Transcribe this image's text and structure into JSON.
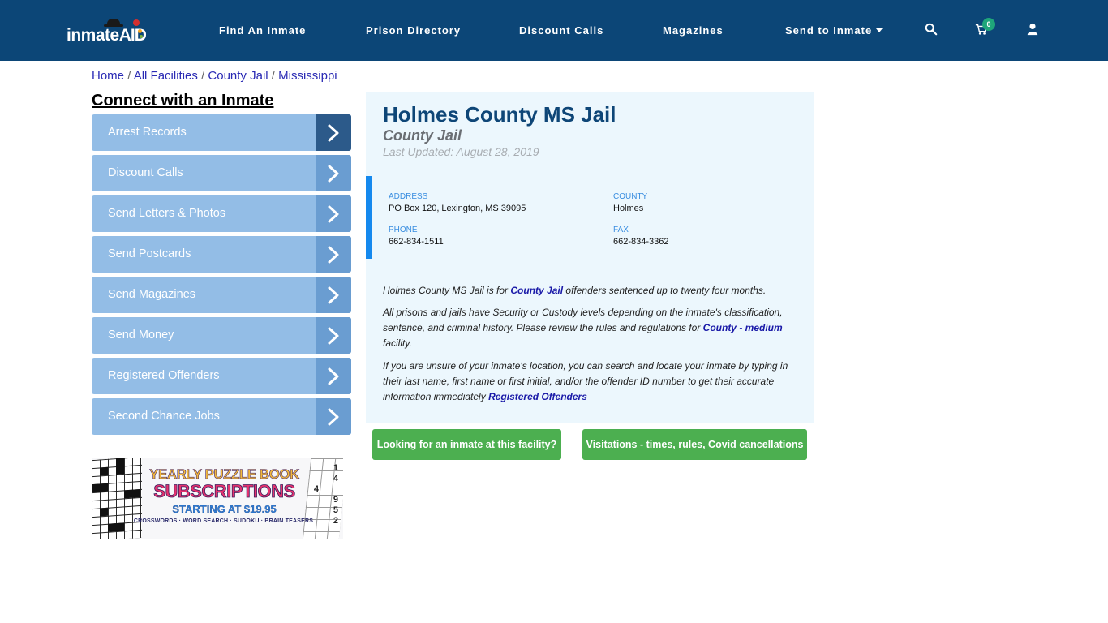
{
  "header": {
    "logo": {
      "text_main": "inmate",
      "text_accent": "AID"
    },
    "nav": [
      {
        "label": "Find An Inmate"
      },
      {
        "label": "Prison Directory"
      },
      {
        "label": "Discount Calls"
      },
      {
        "label": "Magazines"
      },
      {
        "label": "Send to Inmate",
        "has_dropdown": true
      }
    ],
    "icons": {
      "search": "search-icon",
      "cart": "cart-icon",
      "user": "user-icon"
    },
    "cart_count": "0",
    "colors": {
      "background": "#0c4677",
      "badge": "#1fa67a"
    }
  },
  "breadcrumb": [
    {
      "label": "Home"
    },
    {
      "label": "All Facilities"
    },
    {
      "label": "County Jail"
    },
    {
      "label": "Mississippi"
    }
  ],
  "breadcrumb_separator": "/",
  "sidebar": {
    "title": "Connect with an Inmate",
    "items": [
      {
        "label": "Arrest Records",
        "active": true
      },
      {
        "label": "Discount Calls"
      },
      {
        "label": "Send Letters & Photos"
      },
      {
        "label": "Send Postcards"
      },
      {
        "label": "Send Magazines"
      },
      {
        "label": "Send Money"
      },
      {
        "label": "Registered Offenders"
      },
      {
        "label": "Second Chance Jobs"
      }
    ],
    "ad": {
      "line1": "YEARLY PUZZLE BOOK",
      "line2": "SUBSCRIPTIONS",
      "line3": "STARTING AT $19.95",
      "line4": "CROSSWORDS · WORD SEARCH · SUDOKU · BRAIN TEASERS",
      "sudoku_digits": [
        "1",
        "4",
        "4",
        "9",
        "5",
        "2"
      ]
    }
  },
  "facility": {
    "name": "Holmes County MS Jail",
    "type": "County Jail",
    "last_updated": "Last Updated: August 28, 2019",
    "address_label": "ADDRESS",
    "address": "PO Box 120, Lexington, MS 39095",
    "county_label": "COUNTY",
    "county": "Holmes",
    "phone_label": "PHONE",
    "phone": "662-834-1511",
    "fax_label": "FAX",
    "fax": "662-834-3362",
    "description": {
      "p1_before": "Holmes County MS Jail is for ",
      "p1_link": "County Jail",
      "p1_after": " offenders sentenced up to twenty four months.",
      "p2_before": "All prisons and jails have Security or Custody levels depending on the inmate's classification, sentence, and criminal history. Please review the rules and regulations for ",
      "p2_link": "County - medium",
      "p2_after": " facility.",
      "p3_before": "If you are unsure of your inmate's location, you can search and locate your inmate by typing in their last name, first name or first initial, and/or the offender ID number to get their accurate information immediately ",
      "p3_link": "Registered Offenders"
    },
    "buttons": {
      "find_inmate": "Looking for an inmate at this facility?",
      "visitations": "Visitations - times, rules, Covid cancellations"
    }
  }
}
